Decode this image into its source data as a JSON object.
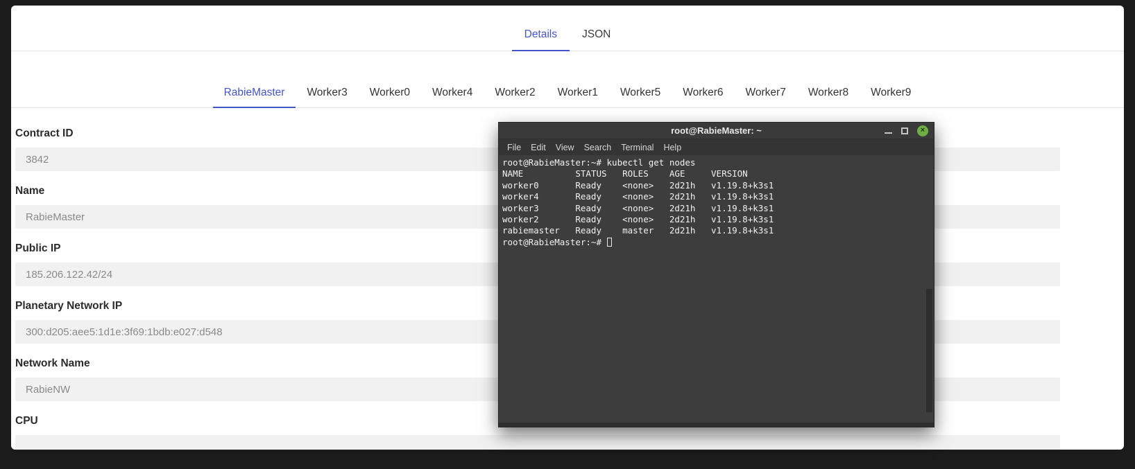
{
  "colors": {
    "accent": "#4355c5",
    "frame_background": "#1b1b1b",
    "page_background": "#ffffff",
    "input_background": "#f1f1f1",
    "input_text": "#8a8a8a",
    "terminal_body": "#3d3d3d",
    "terminal_titlebar": "#3a3a3a",
    "terminal_menubar": "#343434",
    "terminal_text": "#f1f1f1",
    "close_button_green": "#6fae44"
  },
  "view_tabs": [
    {
      "label": "Details",
      "active": true
    },
    {
      "label": "JSON",
      "active": false
    }
  ],
  "node_tabs": [
    {
      "label": "RabieMaster",
      "active": true
    },
    {
      "label": "Worker3",
      "active": false
    },
    {
      "label": "Worker0",
      "active": false
    },
    {
      "label": "Worker4",
      "active": false
    },
    {
      "label": "Worker2",
      "active": false
    },
    {
      "label": "Worker1",
      "active": false
    },
    {
      "label": "Worker5",
      "active": false
    },
    {
      "label": "Worker6",
      "active": false
    },
    {
      "label": "Worker7",
      "active": false
    },
    {
      "label": "Worker8",
      "active": false
    },
    {
      "label": "Worker9",
      "active": false
    }
  ],
  "form": {
    "fields": [
      {
        "label": "Contract ID",
        "value": "3842"
      },
      {
        "label": "Name",
        "value": "RabieMaster"
      },
      {
        "label": "Public IP",
        "value": "185.206.122.42/24"
      },
      {
        "label": "Planetary Network IP",
        "value": "300:d205:aee5:1d1e:3f69:1bdb:e027:d548"
      },
      {
        "label": "Network Name",
        "value": "RabieNW"
      },
      {
        "label": "CPU",
        "value": ""
      }
    ]
  },
  "terminal": {
    "title": "root@RabieMaster: ~",
    "close_glyph": "×",
    "menu": [
      {
        "label": "File"
      },
      {
        "label": "Edit"
      },
      {
        "label": "View"
      },
      {
        "label": "Search"
      },
      {
        "label": "Terminal"
      },
      {
        "label": "Help"
      }
    ],
    "lines": [
      "root@RabieMaster:~# kubectl get nodes",
      "NAME          STATUS   ROLES    AGE     VERSION",
      "worker0       Ready    <none>   2d21h   v1.19.8+k3s1",
      "worker4       Ready    <none>   2d21h   v1.19.8+k3s1",
      "worker3       Ready    <none>   2d21h   v1.19.8+k3s1",
      "worker2       Ready    <none>   2d21h   v1.19.8+k3s1",
      "rabiemaster   Ready    master   2d21h   v1.19.8+k3s1"
    ],
    "prompt": "root@RabieMaster:~# "
  }
}
